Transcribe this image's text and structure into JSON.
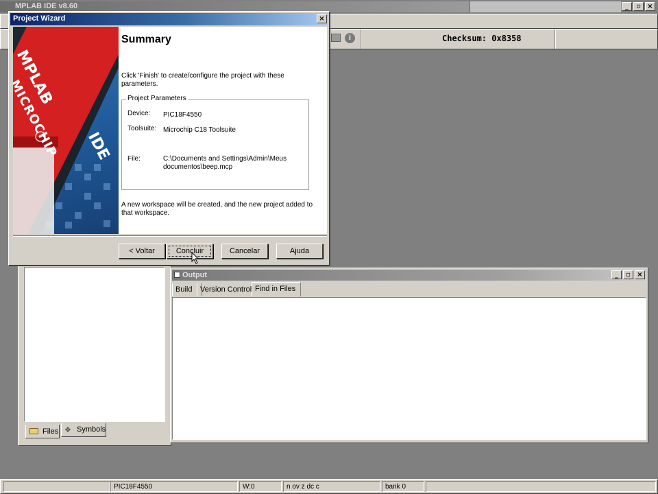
{
  "app": {
    "title": "MPLAB IDE v8.60",
    "checksum": "Checksum:  0x8358"
  },
  "wizard": {
    "title": "Project Wizard",
    "heading": "Summary",
    "intro": "Click 'Finish' to create/configure the project with these parameters.",
    "group_label": "Project Parameters",
    "device_label": "Device:",
    "device_value": "PIC18F4550",
    "toolsuite_label": "Toolsuite:",
    "toolsuite_value": "Microchip C18 Toolsuite",
    "file_label": "File:",
    "file_value_line1": "C:\\Documents and Settings\\Admin\\Meus",
    "file_value_line2": "documentos\\beep.mcp",
    "note": "A new workspace will be created, and the new project added to that workspace.",
    "buttons": {
      "back": "< Voltar",
      "finish": "Concluir",
      "cancel": "Cancelar",
      "help": "Ajuda"
    },
    "splash": {
      "brand": "MICROCHIP",
      "product": "MPLAB",
      "ide": "IDE"
    }
  },
  "output": {
    "title": "Output",
    "tabs": [
      "Build",
      "Version Control",
      "Find in Files"
    ],
    "active_tab": "Find in Files"
  },
  "workspace": {
    "tabs": [
      "Files",
      "Symbols"
    ]
  },
  "statusbar": {
    "device": "PIC18F4550",
    "w": "W:0",
    "flags": "n ov z dc c",
    "bank": "bank 0"
  }
}
